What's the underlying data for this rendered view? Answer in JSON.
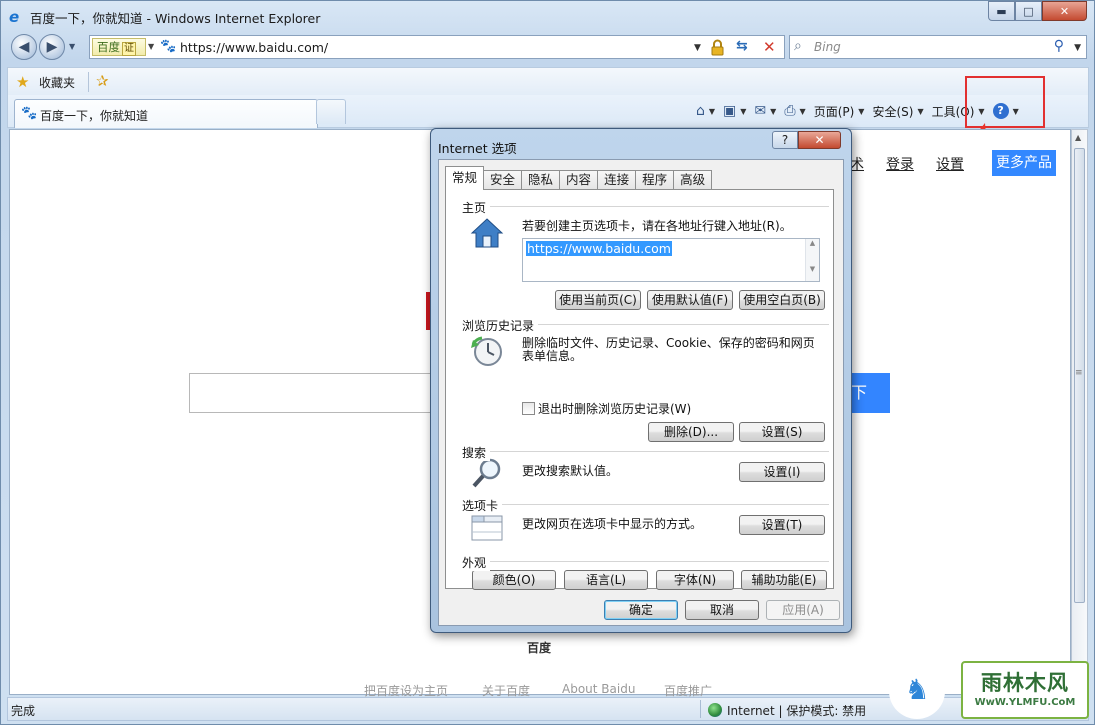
{
  "window": {
    "title": "百度一下，你就知道 - Windows Internet Explorer",
    "min_glyph": "▬",
    "max_glyph": "□",
    "close_glyph": "✕"
  },
  "nav": {
    "back_glyph": "◀",
    "forward_glyph": "▶",
    "dropdown_glyph": "▼",
    "site_badge": "百度",
    "cert_label": "证",
    "url": "https://www.baidu.com/",
    "search_placeholder": "Bing"
  },
  "favorites": {
    "label": "收藏夹"
  },
  "tab": {
    "title": "百度一下，你就知道"
  },
  "commandbar": {
    "page": "页面(P)",
    "safety": "安全(S)",
    "tools": "工具(O)",
    "help": "?"
  },
  "baidu_page": {
    "partial_link": "术",
    "login": "登录",
    "settings": "设置",
    "more_products": "更多产品",
    "search_button_partial": "下",
    "logo_caption": "百度",
    "footer": [
      "把百度设为主页",
      "关于百度",
      "About  Baidu",
      "百度推广"
    ]
  },
  "status": {
    "text": "完成",
    "zone": "Internet | 保护模式: 禁用"
  },
  "watermark": {
    "name": "雨林木风",
    "url": "WwW.YLMFU.CoM"
  },
  "dialog": {
    "title": "Internet 选项",
    "help": "?",
    "close": "✕",
    "tabs": [
      "常规",
      "安全",
      "隐私",
      "内容",
      "连接",
      "程序",
      "高级"
    ],
    "home": {
      "label": "主页",
      "desc": "若要创建主页选项卡，请在各地址行键入地址(R)。",
      "value": "https://www.baidu.com",
      "btn_current": "使用当前页(C)",
      "btn_default": "使用默认值(F)",
      "btn_blank": "使用空白页(B)"
    },
    "history": {
      "label": "浏览历史记录",
      "desc_line1": "删除临时文件、历史记录、Cookie、保存的密码和网页",
      "desc_line2": "表单信息。",
      "checkbox": "退出时删除浏览历史记录(W)",
      "btn_delete": "删除(D)...",
      "btn_settings": "设置(S)"
    },
    "search": {
      "label": "搜索",
      "desc": "更改搜索默认值。",
      "btn_settings": "设置(I)"
    },
    "tabs_section": {
      "label": "选项卡",
      "desc": "更改网页在选项卡中显示的方式。",
      "btn_settings": "设置(T)"
    },
    "appearance": {
      "label": "外观",
      "btn_colors": "颜色(O)",
      "btn_languages": "语言(L)",
      "btn_fonts": "字体(N)",
      "btn_accessibility": "辅助功能(E)"
    },
    "ok": "确定",
    "cancel": "取消",
    "apply": "应用(A)"
  }
}
